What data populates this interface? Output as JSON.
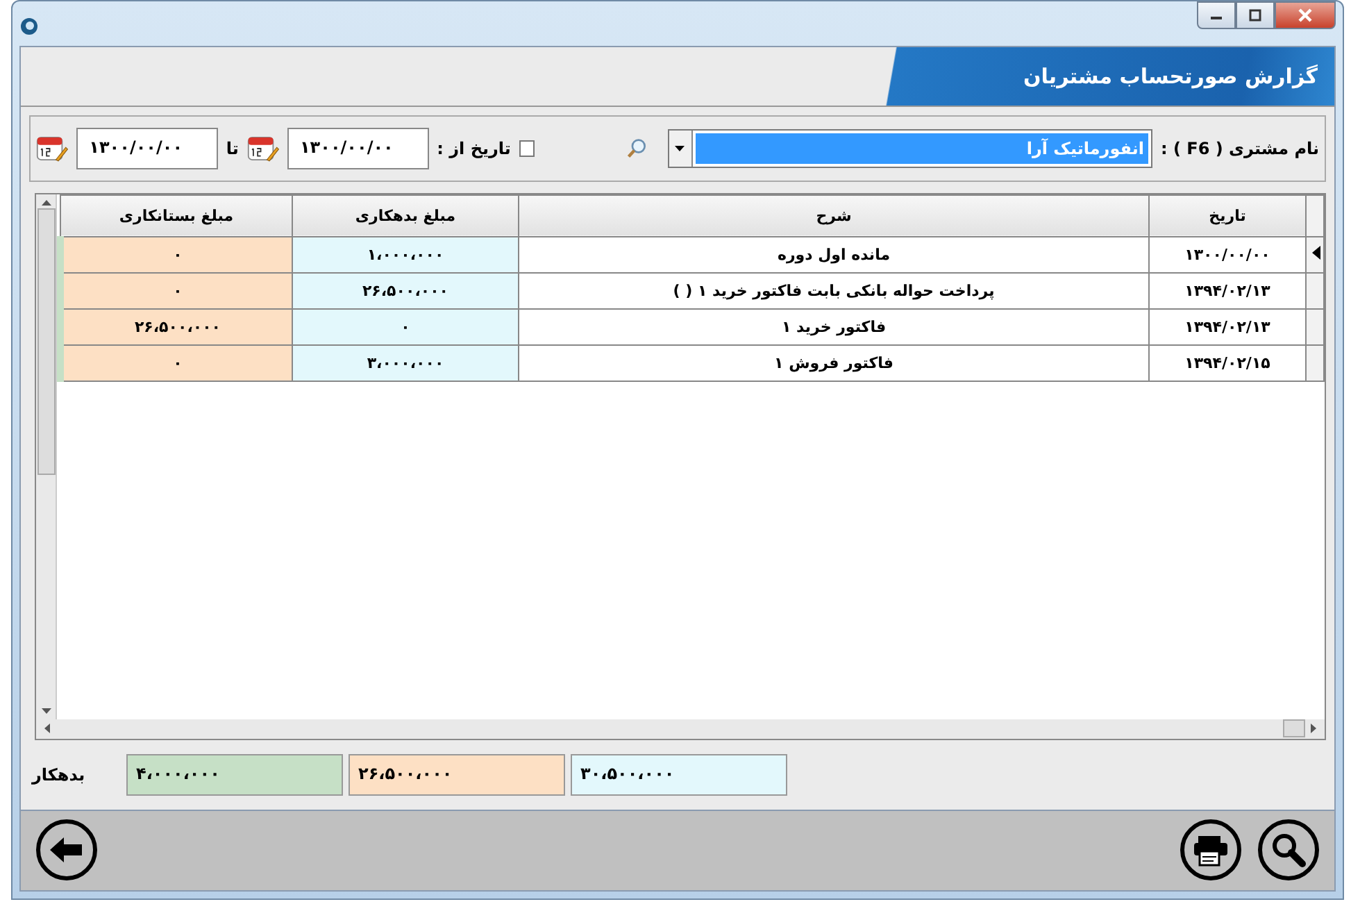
{
  "window": {
    "title": "گزارش صورتحساب مشتریان"
  },
  "filter": {
    "customer_label": "نام مشتری ( F6 ) :",
    "customer_value": "انفورماتیک آرا",
    "date_from": {
      "label": "تاریخ از :",
      "checked": false,
      "value": "۱۳۰۰/۰۰/۰۰"
    },
    "date_to": {
      "label": "تا",
      "value": "۱۳۰۰/۰۰/۰۰"
    }
  },
  "table": {
    "columns": [
      "تاریخ",
      "شرح",
      "مبلغ بدهکاری",
      "مبلغ بستانکاری"
    ],
    "rows": [
      {
        "selected": true,
        "cells": [
          "۱۳۰۰/۰۰/۰۰",
          "مانده اول دوره",
          "۱،۰۰۰،۰۰۰",
          "۰"
        ]
      },
      {
        "selected": false,
        "cells": [
          "۱۳۹۴/۰۲/۱۳",
          "پرداخت حواله بانکی بابت فاکتور خرید ۱ ( )",
          "۲۶،۵۰۰،۰۰۰",
          "۰"
        ]
      },
      {
        "selected": false,
        "cells": [
          "۱۳۹۴/۰۲/۱۳",
          "فاکتور خرید ۱",
          "۰",
          "۲۶،۵۰۰،۰۰۰"
        ]
      },
      {
        "selected": false,
        "cells": [
          "۱۳۹۴/۰۲/۱۵",
          "فاکتور فروش ۱",
          "۳،۰۰۰،۰۰۰",
          "۰"
        ]
      }
    ]
  },
  "totals": [
    {
      "value": "۳۰،۵۰۰،۰۰۰",
      "color": "#e3f8fc"
    },
    {
      "value": "۲۶،۵۰۰،۰۰۰",
      "color": "#fde0c4"
    },
    {
      "value": "۴،۰۰۰،۰۰۰",
      "color": "#c6e0c6"
    }
  ],
  "balance_label": "بدهکار"
}
